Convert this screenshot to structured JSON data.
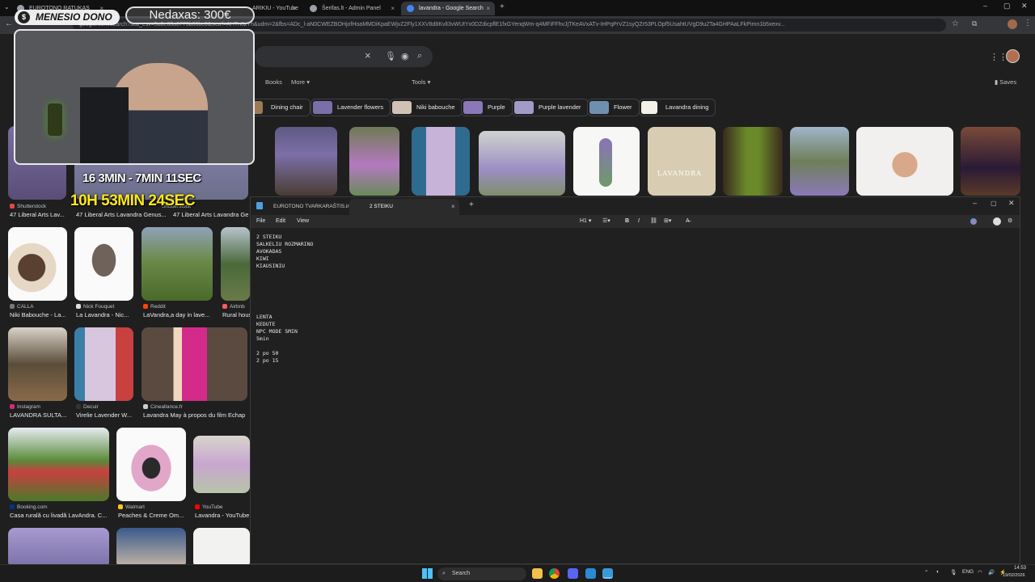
{
  "browser": {
    "tabs": [
      {
        "title": "EUROTONO RATUKAS"
      },
      {
        "title": "ARIKIU - YouTube"
      },
      {
        "title": "Šerifas.lt - Admin Panel"
      },
      {
        "title": "lavandra - Google Search"
      }
    ],
    "address": "google.com/search?sca_esv=5a8e68a6773b86bc6&sxsrf=AHTn8zYh&udm=2&fbs=ADc_l-aN0CWEZBOHjofHoaMMDiKpaEWjvZ2Fly1XXV8d8KvlI3vWUtYx0DZdicpflE1fxGYenqWm-q4MFiFFhvJjTKeAVxATv-IHPqPrVZ1syQZr53PLOpf5UsahtUVgD9u2Ta4GHPAaLFkPimn1b5xexv..."
  },
  "google": {
    "nav": {
      "books": "Books",
      "more": "More",
      "tools": "Tools",
      "saves": "Saves"
    },
    "chips": [
      {
        "label": "Dining chair"
      },
      {
        "label": "Lavender flowers"
      },
      {
        "label": "Niki babouche"
      },
      {
        "label": "Purple"
      },
      {
        "label": "Purple lavender"
      },
      {
        "label": "Flower"
      },
      {
        "label": "Lavandra dining"
      }
    ],
    "results": [
      {
        "source": "Shutterstock",
        "caption": "47 Liberal Arts Lav..."
      },
      {
        "source": "Shutterstock",
        "caption": "47 Liberal Arts Lavandra Genus..."
      },
      {
        "caption": "47 Liberal Arts Lavandra Ge..."
      },
      {
        "source": "CALLA",
        "caption": "Niki Babouche - La..."
      },
      {
        "source": "Nick Fouquet",
        "caption": "La Lavandra - Nic..."
      },
      {
        "source": "Reddit",
        "caption": "LaVandra,a day in lave..."
      },
      {
        "source": "Airbnb",
        "caption": "Rural hous"
      },
      {
        "source": "Instagram",
        "caption": "LAVANDRA SULTA..."
      },
      {
        "source": "Decuir",
        "caption": "Virelie Lavender W..."
      },
      {
        "source": "Cineallance.fr",
        "caption": "Lavandra May à propos du film Echap"
      },
      {
        "source": "Booking.com",
        "caption": "Casa rurală cu livadă LavAndra. C..."
      },
      {
        "source": "Walmart",
        "caption": "Peaches & Creme Om..."
      },
      {
        "source": "YouTube",
        "caption": "Lavandra - YouTube"
      }
    ],
    "lavandra_tile_text": "LAVANDRA"
  },
  "overlay": {
    "dono_label": "MENESIO DONO",
    "coin_symbol": "$",
    "nedaxas": "Nedaxas: 300€",
    "timer_small": "16 3MIN - 7MIN 11SEC",
    "timer_big": "10H 53MIN 24SEC"
  },
  "notepad": {
    "tabs": [
      {
        "title": "EUROTONO TVARKARAŠTIS.ini"
      },
      {
        "title": "2 STEIKU"
      }
    ],
    "menu": {
      "file": "File",
      "edit": "Edit",
      "view": "View",
      "heading": "H1"
    },
    "content": "2 STEIKU\nSALKELIU ROZMARINO\nAVOKADAS\nKIWI\nKIAUSINIU\n\n\n\n\n\n\nLENTA\nKEDUTE\nNPC MODE 5MIN\n5min\n\n2 po 50\n2 po 15"
  },
  "taskbar": {
    "search": "Search",
    "lang": "ENG",
    "time": "14:53",
    "date": "19/02/2026"
  },
  "colors": {
    "accent_yellow": "#ffe81a",
    "lavender": "#8e7cc3"
  }
}
